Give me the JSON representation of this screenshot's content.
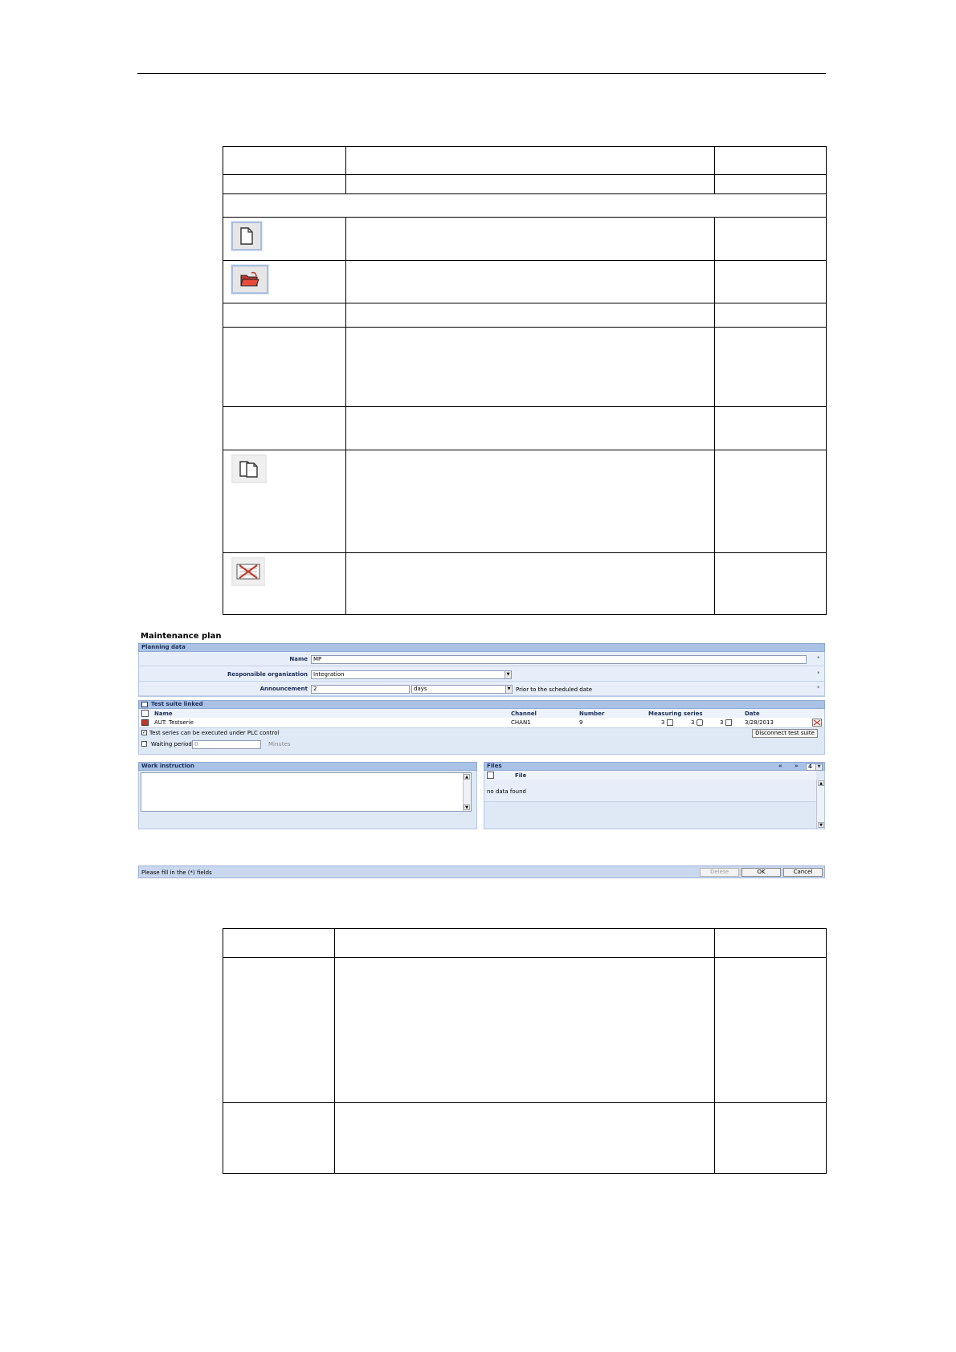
{
  "screenshot": {
    "title": "Maintenance plan",
    "planning_section": "Planning data",
    "name_label": "Name",
    "name_value": "MP",
    "org_label": "Responsible organization",
    "org_value": "Integration",
    "announcement_label": "Announcement",
    "announcement_value": "2",
    "announcement_unit": "days",
    "announcement_hint": "Prior to the scheduled date",
    "required_marker": "*",
    "test_suite_section": "Test suite linked",
    "columns": {
      "name": "Name",
      "channel": "Channel",
      "number": "Number",
      "measuring_series": "Measuring series",
      "date": "Date"
    },
    "row": {
      "name": "AUT: Testserie",
      "channel": "CHAN1",
      "number": "9",
      "ms1": "3",
      "ms2": "3",
      "ms3": "3",
      "date": "3/28/2013"
    },
    "plc_checkbox_label": "Test series can be executed under PLC control",
    "waiting_label": "Waiting period",
    "waiting_value": "0",
    "waiting_unit": "Minutes",
    "disconnect_button": "Disconnect test suite",
    "work_instruction_section": "Work instruction",
    "files_section": "Files",
    "files_page_size": "4",
    "files_column": "File",
    "files_empty": "no data found",
    "status_text": "Please fill in the (*) fields",
    "delete_button": "Delete",
    "ok_button": "OK",
    "cancel_button": "Cancel"
  }
}
